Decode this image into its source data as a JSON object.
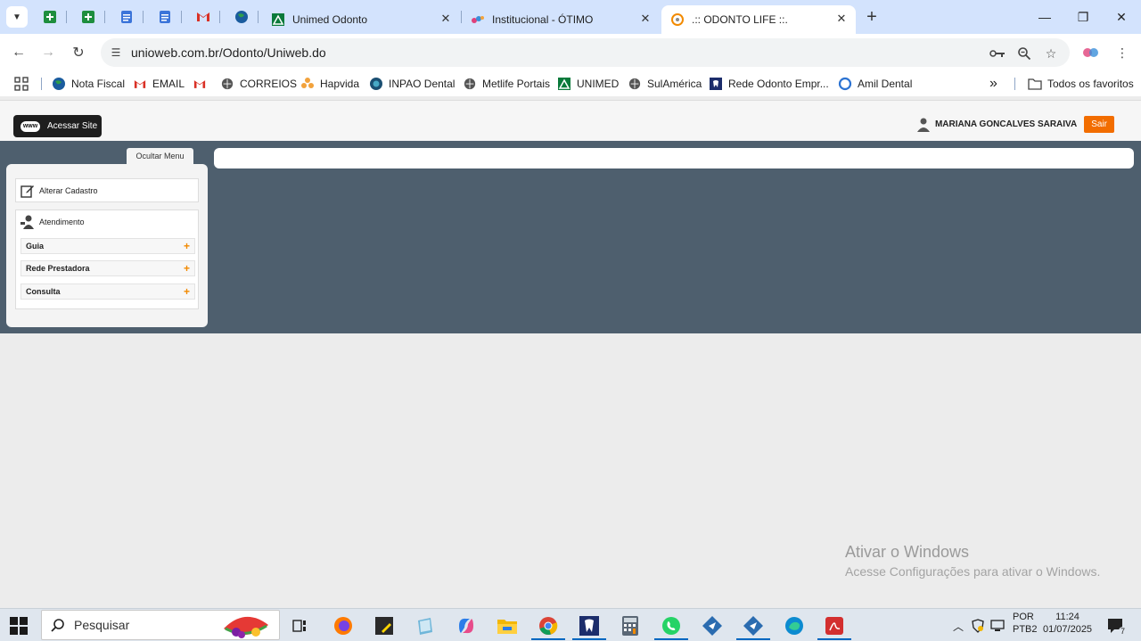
{
  "browser": {
    "tabs": [
      {
        "title": "Unimed Odonto",
        "icon": "unimed-icon",
        "active": false
      },
      {
        "title": "Institucional - ÓTIMO",
        "icon": "otimo-icon",
        "active": false
      },
      {
        "title": ".:: ODONTO LIFE ::.",
        "icon": "odontolife-icon",
        "active": true
      }
    ],
    "close_glyph": "✕",
    "new_tab_glyph": "+",
    "url": "unioweb.com.br/Odonto/Uniweb.do",
    "window_controls": {
      "minimize": "—",
      "maximize": "❐",
      "close": "✕"
    }
  },
  "bookmarks": [
    {
      "label": "Nota Fiscal",
      "icon": "globe-icon"
    },
    {
      "label": "EMAIL",
      "icon": "gmail-icon"
    },
    {
      "label": "",
      "icon": "gmail-icon"
    },
    {
      "label": "CORREIOS",
      "icon": "globe-icon"
    },
    {
      "label": "Hapvida",
      "icon": "hapvida-icon"
    },
    {
      "label": "INPAO Dental",
      "icon": "inpao-icon"
    },
    {
      "label": "Metlife Portais",
      "icon": "globe-icon"
    },
    {
      "label": "UNIMED",
      "icon": "unimed-icon"
    },
    {
      "label": "SulAmérica",
      "icon": "globe-icon"
    },
    {
      "label": "Rede Odonto Empr...",
      "icon": "rede-odonto-icon"
    },
    {
      "label": "Amil Dental",
      "icon": "amil-icon"
    }
  ],
  "bookmarks_more": "»",
  "all_favorites": "Todos os favoritos",
  "page": {
    "acessar_site": "Acessar Site",
    "www_badge": "www",
    "user_name": "MARIANA GONCALVES SARAIVA",
    "sair": "Sair",
    "ocultar_menu": "Ocultar Menu",
    "menu": {
      "alterar_cadastro": "Alterar Cadastro",
      "atendimento": "Atendimento",
      "items": [
        {
          "label": "Guia"
        },
        {
          "label": "Rede Prestadora"
        },
        {
          "label": "Consulta"
        }
      ],
      "plus": "+"
    }
  },
  "watermark": {
    "line1": "Ativar o Windows",
    "line2": "Acesse Configurações para ativar o Windows."
  },
  "taskbar": {
    "search_placeholder": "Pesquisar",
    "lang_top": "POR",
    "lang_bottom": "PTB2",
    "time": "11:24",
    "date": "01/07/2025",
    "notifications": "7"
  },
  "colors": {
    "tabstrip": "#d3e3fd",
    "dark_band": "#4e5f6e",
    "sair": "#f26d00",
    "plus": "#f28a00"
  }
}
